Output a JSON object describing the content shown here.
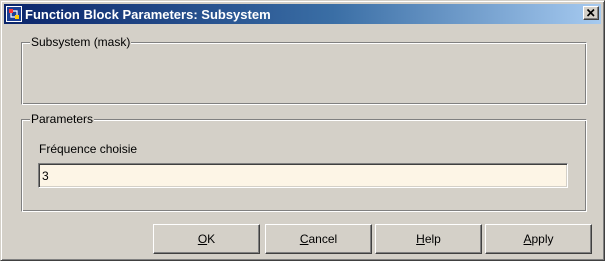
{
  "window": {
    "title": "Function Block Parameters: Subsystem",
    "icon": "simulink-block-icon",
    "close_icon": "close-icon",
    "titlebar_color": "#0a246a"
  },
  "subsystem_group": {
    "legend": "Subsystem (mask)"
  },
  "parameters_group": {
    "legend": "Parameters",
    "field_label": "Fréquence choisie",
    "field_value": "3",
    "field_background": "#fdf5e6"
  },
  "buttons": {
    "ok": {
      "mnemonic": "O",
      "rest": "K"
    },
    "cancel": {
      "mnemonic": "C",
      "rest": "ancel"
    },
    "help": {
      "mnemonic": "H",
      "rest": "elp"
    },
    "apply": {
      "mnemonic": "A",
      "rest": "pply"
    }
  }
}
